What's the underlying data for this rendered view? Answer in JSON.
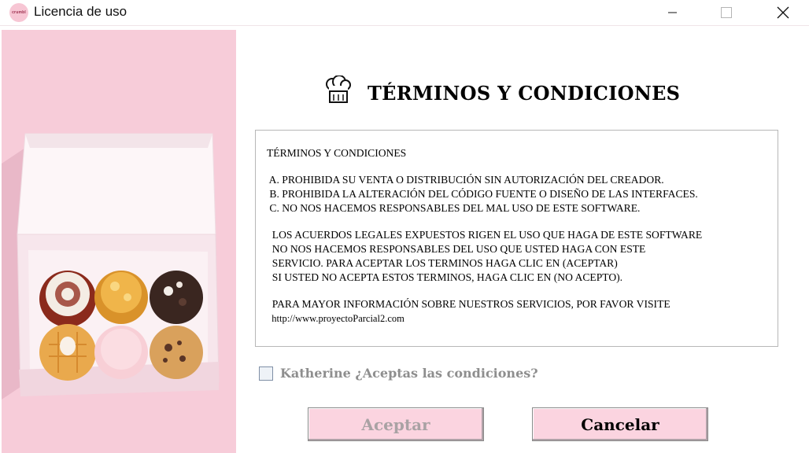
{
  "window": {
    "title": "Licencia de uso",
    "app_icon_text": "crumbl"
  },
  "header": {
    "title": "TÉRMINOS Y CONDICIONES",
    "icon": "chef-hat-icon"
  },
  "terms": {
    "heading": "TÉRMINOS Y CONDICIONES",
    "items": [
      " A. PROHIBIDA SU VENTA O DISTRIBUCIÓN SIN AUTORIZACIÓN DEL CREADOR.",
      " B. PROHIBIDA LA ALTERACIÓN DEL CÓDIGO FUENTE O DISEÑO DE LAS INTERFACES.",
      " C. NO NOS HACEMOS RESPONSABLES DEL MAL USO DE ESTE SOFTWARE."
    ],
    "paragraph": [
      "  LOS ACUERDOS LEGALES EXPUESTOS RIGEN EL USO QUE HAGA DE ESTE SOFTWARE",
      "  NO NOS HACEMOS RESPONSABLES DEL USO QUE USTED HAGA CON ESTE",
      "  SERVICIO. PARA ACEPTAR LOS TERMINOS HAGA CLIC EN (ACEPTAR)",
      "  SI USTED NO ACEPTA ESTOS TERMINOS, HAGA CLIC EN (NO ACEPTO)."
    ],
    "info": "  PARA MAYOR INFORMACIÓN SOBRE NUESTROS SERVICIOS, POR FAVOR VISITE",
    "url": "  http://www.proyectoParcial2.com"
  },
  "acceptance": {
    "label": "Katherine  ¿Aceptas las condiciones?",
    "checked": false
  },
  "buttons": {
    "accept": "Aceptar",
    "cancel": "Cancelar"
  },
  "colors": {
    "panel_pink": "#f7ccd9",
    "button_pink": "#fbd4e0",
    "disabled_text": "#a9a2a4"
  }
}
